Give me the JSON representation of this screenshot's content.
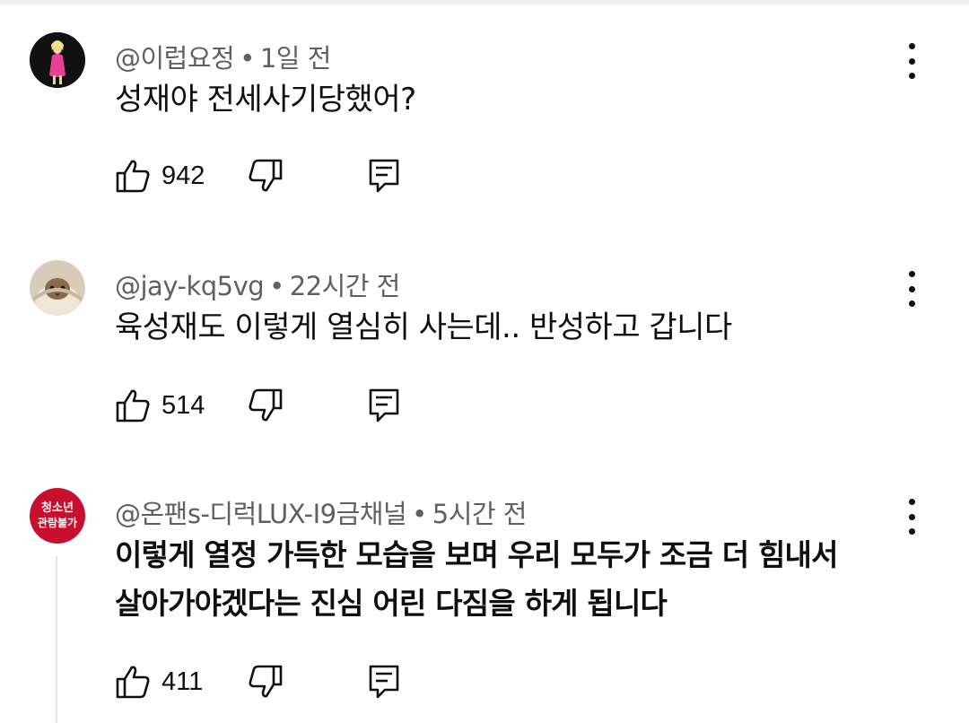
{
  "comments": [
    {
      "author": "@이럽요정",
      "separator": "•",
      "time": "1일 전",
      "text": "성재야 전세사기당했어?",
      "likes": "942",
      "avatar_icon": "avatar-figure-pink"
    },
    {
      "author": "@jay-kq5vg",
      "separator": "•",
      "time": "22시간 전",
      "text": "육성재도 이렇게 열심히 사는데.. 반성하고 갑니다",
      "likes": "514",
      "avatar_icon": "avatar-cat-blanket"
    },
    {
      "author": "@온팬s-디럭LUX-I9금채널",
      "separator": "•",
      "time": "5시간 전",
      "text_lines": [
        "이렇게 열정 가득한 모습을 보며 우리 모두가 조금 더 힘내서",
        "살아가야겠다는 진심 어린 다짐을 하게 됩니다"
      ],
      "likes": "411",
      "avatar_icon": "avatar-age-restricted-badge",
      "avatar_text_lines": [
        "청소년",
        "관람불가"
      ]
    }
  ],
  "colors": {
    "meta_gray": "#606060",
    "text": "#0f0f0f",
    "badge_red": "#c8102e"
  },
  "icons": [
    "thumbs-up-icon",
    "thumbs-down-icon",
    "reply-icon",
    "more-vert-icon"
  ]
}
